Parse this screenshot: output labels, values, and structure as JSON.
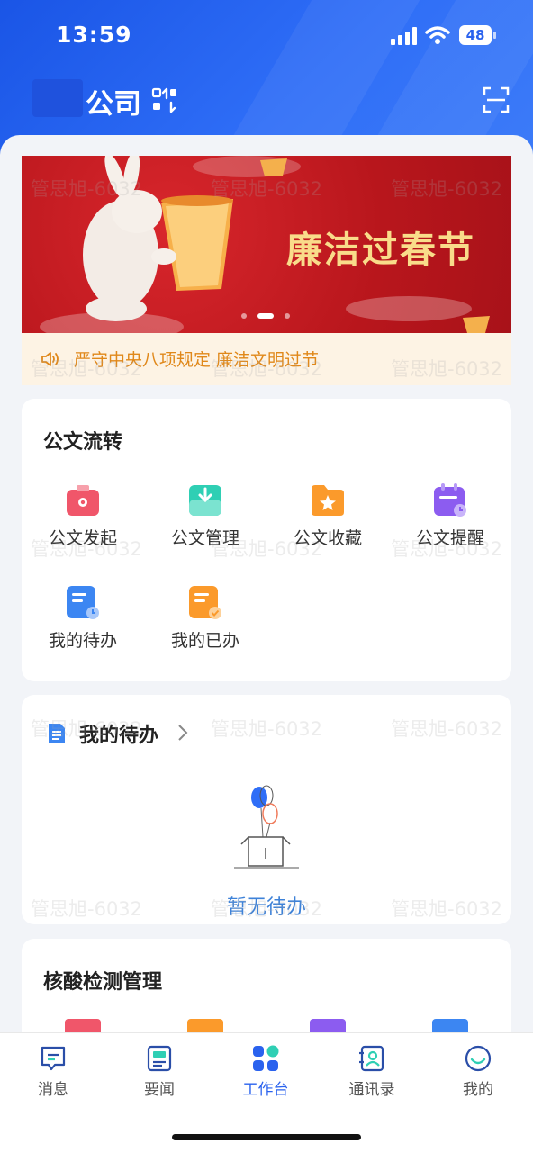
{
  "status_bar": {
    "time": "13:59",
    "battery": "48"
  },
  "header": {
    "company": "公司"
  },
  "banner": {
    "title": "廉洁过春节",
    "active_index": 2,
    "count": 3
  },
  "notice": {
    "text": "严守中央八项规定 廉洁文明过节"
  },
  "doc_flow": {
    "title": "公文流转",
    "items": [
      {
        "label": "公文发起",
        "icon": "briefcase-icon",
        "color": "#f0566a"
      },
      {
        "label": "公文管理",
        "icon": "inbox-download-icon",
        "color": "#2fcfb4"
      },
      {
        "label": "公文收藏",
        "icon": "star-folder-icon",
        "color": "#fb9a2b"
      },
      {
        "label": "公文提醒",
        "icon": "calendar-clock-icon",
        "color": "#8c5cf0"
      },
      {
        "label": "我的待办",
        "icon": "document-clock-icon",
        "color": "#3c86f2"
      },
      {
        "label": "我的已办",
        "icon": "document-check-icon",
        "color": "#fb9a2b"
      }
    ]
  },
  "todo": {
    "title": "我的待办",
    "empty_text": "暂无待办"
  },
  "nucleic": {
    "title": "核酸检测管理"
  },
  "watermark": "管思旭-6032",
  "tabbar": {
    "items": [
      {
        "label": "消息",
        "icon": "message-icon"
      },
      {
        "label": "要闻",
        "icon": "news-icon"
      },
      {
        "label": "工作台",
        "icon": "workbench-icon",
        "active": true
      },
      {
        "label": "通讯录",
        "icon": "contacts-icon"
      },
      {
        "label": "我的",
        "icon": "profile-icon"
      }
    ]
  },
  "colors": {
    "accent": "#2a62ee",
    "notice": "#e0881a",
    "banner_red": "#b8161c",
    "empty_text": "#3e82d8"
  }
}
